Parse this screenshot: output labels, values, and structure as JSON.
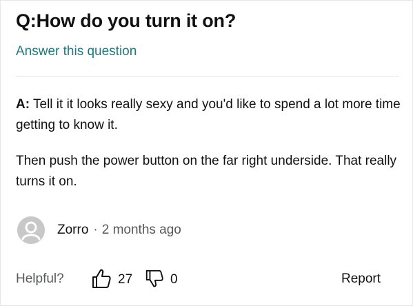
{
  "question": {
    "prefix": "Q:",
    "text": "How do you turn it on?"
  },
  "answer_link": "Answer this question",
  "answer": {
    "prefix": "A:",
    "paragraph1": " Tell it it looks really sexy and you'd like to spend a lot more time getting to know it.",
    "paragraph2": "Then push the power button on the far right underside. That really turns it on."
  },
  "author": {
    "avatar_icon": "default-user-avatar",
    "name": "Zorro",
    "separator": "·",
    "time_ago": "2 months ago"
  },
  "feedback": {
    "helpful_label": "Helpful?",
    "upvote_icon": "thumbs-up-outline",
    "upvotes": "27",
    "downvote_icon": "thumbs-down-outline",
    "downvotes": "0",
    "report_label": "Report"
  },
  "colors": {
    "link": "#1b7a80",
    "text": "#111111",
    "secondary_text": "#565959",
    "avatar_bg": "#c8c8c8",
    "divider": "#e3e3e3"
  }
}
